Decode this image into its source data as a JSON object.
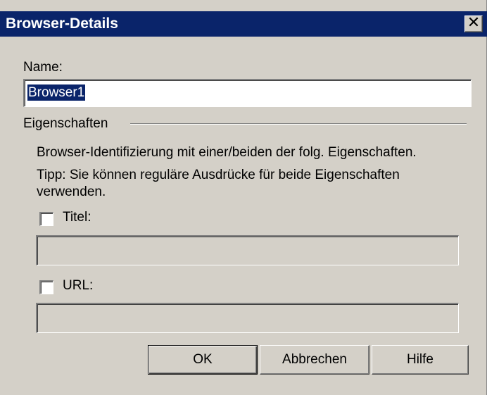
{
  "window": {
    "title": "Browser-Details",
    "close_glyph": "✕"
  },
  "name_field": {
    "label": "Name:",
    "value": "Browser1"
  },
  "properties": {
    "group_label": "Eigenschaften",
    "description": "Browser-Identifizierung mit einer/beiden der folg. Eigenschaften.",
    "tip_line1": "Tipp: Sie können reguläre Ausdrücke für beide Eigenschaften",
    "tip_line2": "verwenden.",
    "title_checkbox": {
      "label": "Titel:",
      "checked": false,
      "value": ""
    },
    "url_checkbox": {
      "label": "URL:",
      "checked": false,
      "value": ""
    }
  },
  "buttons": {
    "ok": "OK",
    "cancel": "Abbrechen",
    "help": "Hilfe"
  },
  "colors": {
    "titlebar": "#0a246a",
    "dialog_bg": "#d4d0c8",
    "selection": "#0a246a"
  }
}
